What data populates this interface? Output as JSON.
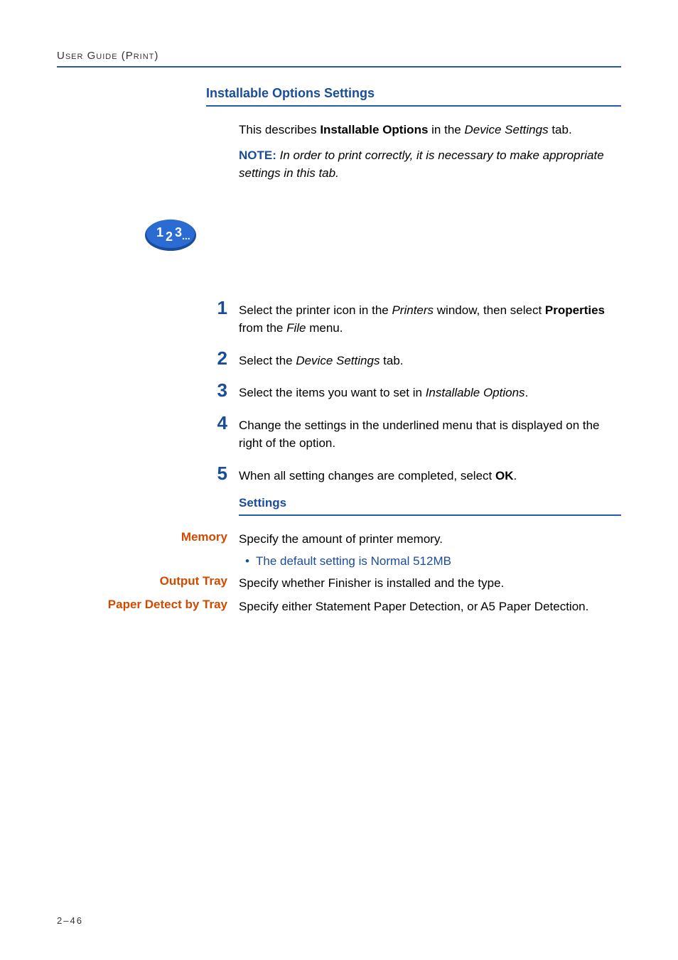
{
  "runningHead": "User Guide (Print)",
  "section": {
    "title": "Installable Options Settings",
    "intro": {
      "pre": "This describes ",
      "bold": "Installable Options",
      "mid": " in the ",
      "ital": "Device Settings",
      "post": " tab."
    },
    "note": {
      "label": "NOTE:",
      "text": " In order to print correctly, it is necessary to make appropriate settings in this tab."
    }
  },
  "steps": [
    {
      "n": "1",
      "pre": "Select the printer icon in the ",
      "i1": "Printers",
      "mid": " window, then select ",
      "b1": "Properties",
      "mid2": " from the ",
      "i2": "File",
      "post": " menu."
    },
    {
      "n": "2",
      "pre": "Select the ",
      "i1": "Device Settings",
      "post": " tab."
    },
    {
      "n": "3",
      "pre": "Select the items you want to set in ",
      "i1": "Installable Options",
      "post": "."
    },
    {
      "n": "4",
      "pre": "Change the settings in the underlined menu that is displayed on the right of the option."
    },
    {
      "n": "5",
      "pre": "When all setting changes are completed, select ",
      "b1": "OK",
      "post": "."
    }
  ],
  "settings": {
    "title": "Settings",
    "rows": [
      {
        "label": "Memory",
        "value": "Specify the amount of printer memory.",
        "bullet": "The default setting is Normal 512MB"
      },
      {
        "label": "Output Tray",
        "value": "Specify whether Finisher is installed and the type."
      },
      {
        "label": "Paper Detect by Tray",
        "value": "Specify either Statement Paper Detection, or A5 Paper Detection."
      }
    ]
  },
  "pageNumber": "2–46",
  "iconAlt": "123 step icon"
}
